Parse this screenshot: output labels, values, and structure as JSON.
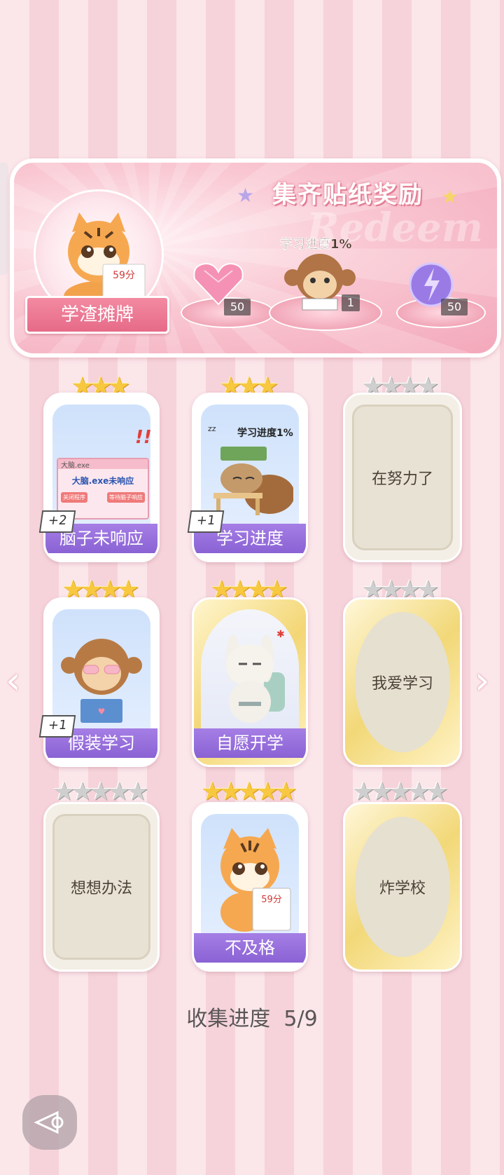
{
  "banner": {
    "title": "集齐贴纸奖励",
    "watermark": "Redeem",
    "mascot_label": "学渣摊牌",
    "mascot_paper": "59分",
    "monkey_caption": "学习进度1%",
    "rewards": [
      {
        "icon": "pink-heart-gem-icon",
        "count": "50"
      },
      {
        "icon": "monkey-sticker-icon",
        "count": "1"
      },
      {
        "icon": "purple-lightning-orb-icon",
        "count": "50"
      }
    ]
  },
  "cards": [
    {
      "name": "脑子未响应",
      "stars_filled": 3,
      "stars_total": 3,
      "badge": "+2",
      "collected": true,
      "art": {
        "window_title": "大脑.exe",
        "message": "大脑.exe未响应",
        "btn1": "关闭程序",
        "btn2": "等待脑子响应",
        "exclaim": "!!!"
      }
    },
    {
      "name": "学习进度",
      "stars_filled": 3,
      "stars_total": 3,
      "badge": "+1",
      "collected": true,
      "art": {
        "caption": "学习进度1%",
        "zz": "zz"
      }
    },
    {
      "name": "在努力了",
      "stars_filled": 0,
      "stars_total": 4,
      "collected": false
    },
    {
      "name": "假装学习",
      "stars_filled": 4,
      "stars_total": 4,
      "badge": "+1",
      "collected": true
    },
    {
      "name": "自愿开学",
      "stars_filled": 4,
      "stars_total": 4,
      "collected": true
    },
    {
      "name": "我爱学习",
      "stars_filled": 0,
      "stars_total": 4,
      "collected": false
    },
    {
      "name": "想想办法",
      "stars_filled": 0,
      "stars_total": 5,
      "collected": false
    },
    {
      "name": "不及格",
      "stars_filled": 5,
      "stars_total": 5,
      "collected": true,
      "art": {
        "paper": "59分"
      }
    },
    {
      "name": "炸学校",
      "stars_filled": 0,
      "stars_total": 5,
      "collected": false
    }
  ],
  "collection_progress": "收集进度  5/9",
  "colors": {
    "accent_pink": "#f38aa2",
    "name_bar_purple": "#9a72dc",
    "star_gold": "#f7c840",
    "star_gray": "#cfcfcf"
  }
}
